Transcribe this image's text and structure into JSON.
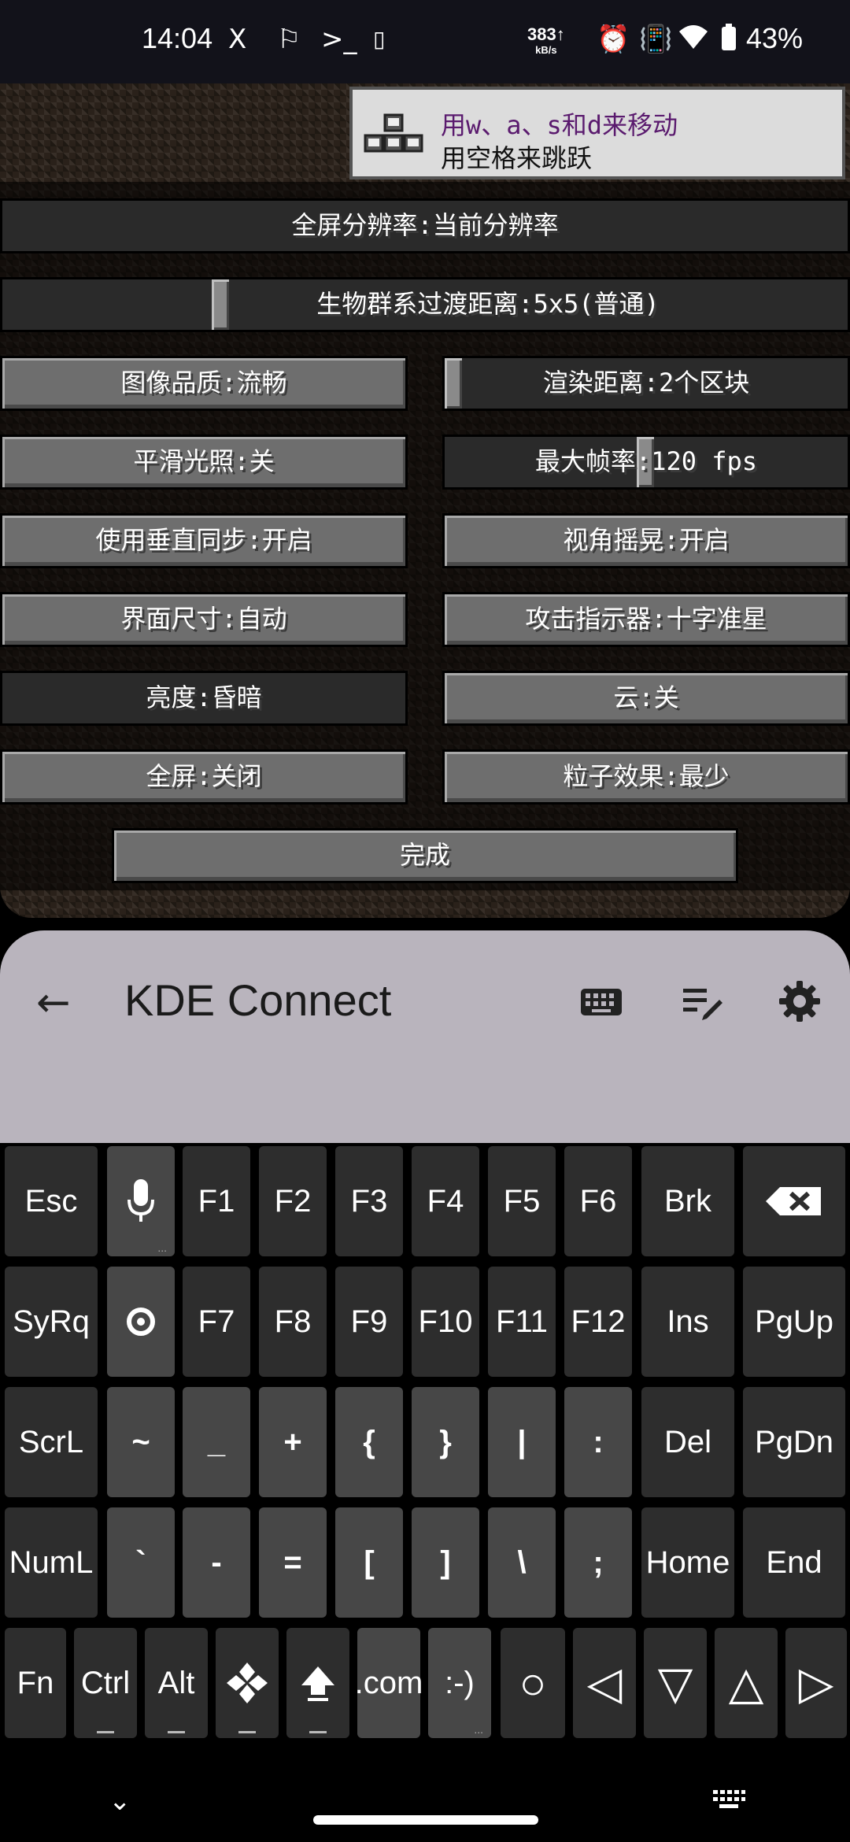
{
  "status_bar": {
    "time": "14:04",
    "net_speed": "383",
    "net_unit": "kB/s",
    "battery": "43%",
    "icons": [
      "x-icon",
      "flag-icon",
      "terminal-icon",
      "screen-record-icon",
      "alarm-icon",
      "vibrate-icon",
      "wifi-icon",
      "battery-icon"
    ]
  },
  "game": {
    "toast": {
      "line1": "用w、a、s和d来移动",
      "line2": "用空格来跳跃"
    },
    "fullscreen_resolution": "全屏分辨率:当前分辨率",
    "biome_blend": "生物群系过渡距离:5x5(普通)",
    "graphics": "图像品质:流畅",
    "render_distance": "渲染距离:2个区块",
    "smooth_lighting": "平滑光照:关",
    "max_framerate": "最大帧率:120 fps",
    "vsync": "使用垂直同步:开启",
    "view_bobbing": "视角摇晃:开启",
    "gui_scale": "界面尺寸:自动",
    "attack_indicator": "攻击指示器:十字准星",
    "brightness": "亮度:昏暗",
    "clouds": "云:关",
    "fullscreen": "全屏:关闭",
    "particles": "粒子效果:最少",
    "done": "完成"
  },
  "kde": {
    "title": "KDE Connect",
    "actions": [
      "keyboard-icon",
      "edit-list-icon",
      "settings-gear-icon"
    ]
  },
  "keyboard": {
    "row1": [
      "Esc",
      "",
      "F1",
      "F2",
      "F3",
      "F4",
      "F5",
      "F6",
      "Brk",
      ""
    ],
    "row2": [
      "SyRq",
      "",
      "F7",
      "F8",
      "F9",
      "F10",
      "F11",
      "F12",
      "Ins",
      "PgUp"
    ],
    "row3": [
      "ScrL",
      "~",
      "_",
      "+",
      "{",
      "}",
      "|",
      ":",
      "Del",
      "PgDn"
    ],
    "row4": [
      "NumL",
      "`",
      "-",
      "=",
      "[",
      "]",
      "\\",
      ";",
      "Home",
      "End"
    ],
    "row5": [
      "Fn",
      "Ctrl",
      "Alt",
      "",
      "",
      ".com",
      ":-)",
      "○",
      "◁",
      "▽",
      "△",
      "▷"
    ]
  },
  "colors": {
    "status_bg": "#12121a",
    "panel_bg": "#b9b4bd",
    "key_bg": "#2d2d2d",
    "key_alt_bg": "#474747",
    "mc_button": "#6e6e6e",
    "toast_accent": "#5a1a6e"
  }
}
